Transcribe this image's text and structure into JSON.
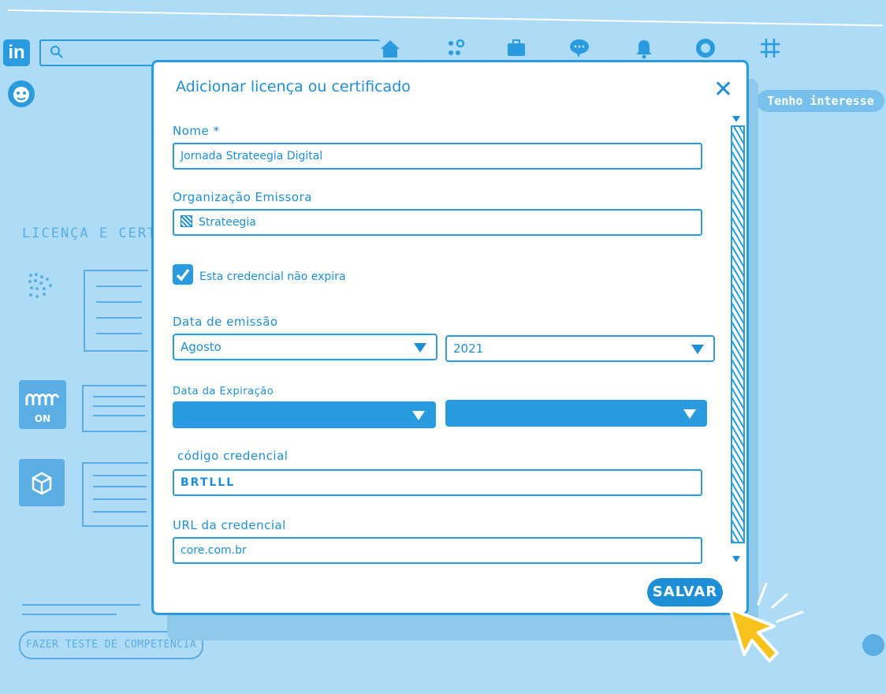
{
  "app": {
    "logo_text": "in"
  },
  "header": {
    "nav_icons": [
      "home-icon",
      "network-icon",
      "jobs-icon",
      "messaging-icon",
      "notifications-icon",
      "profile-icon",
      "grid-icon"
    ]
  },
  "sidebar": {
    "interest_button": "Tenho interesse"
  },
  "background": {
    "section_title": "LICENÇA E CERTIF",
    "tile_label": "ON",
    "test_button": "FAZER TESTE DE COMPETENCIA"
  },
  "modal": {
    "title": "Adicionar licença ou certificado",
    "close_glyph": "✕",
    "name_label": "Nome *",
    "name_value": "Jornada Strateegia Digital",
    "org_label": "Organização Emissora",
    "org_value": "Strateegia",
    "no_expire_label": "Esta credencial não expira",
    "no_expire_checked": true,
    "issue_label": "Data de emissão",
    "issue_month": "Agosto",
    "issue_year": "2021",
    "expiry_label": "Data da Expiração",
    "expiry_month": "",
    "expiry_year": "",
    "credential_code_label": "código credencial",
    "credential_code_value": "BRTLLL",
    "credential_url_label": "URL da credencial",
    "credential_url_value": "core.com.br",
    "save_label": "SALVAR"
  },
  "colors": {
    "background": "#aedcf7",
    "accent": "#2a9bdf",
    "cursor": "#f7c21a"
  }
}
